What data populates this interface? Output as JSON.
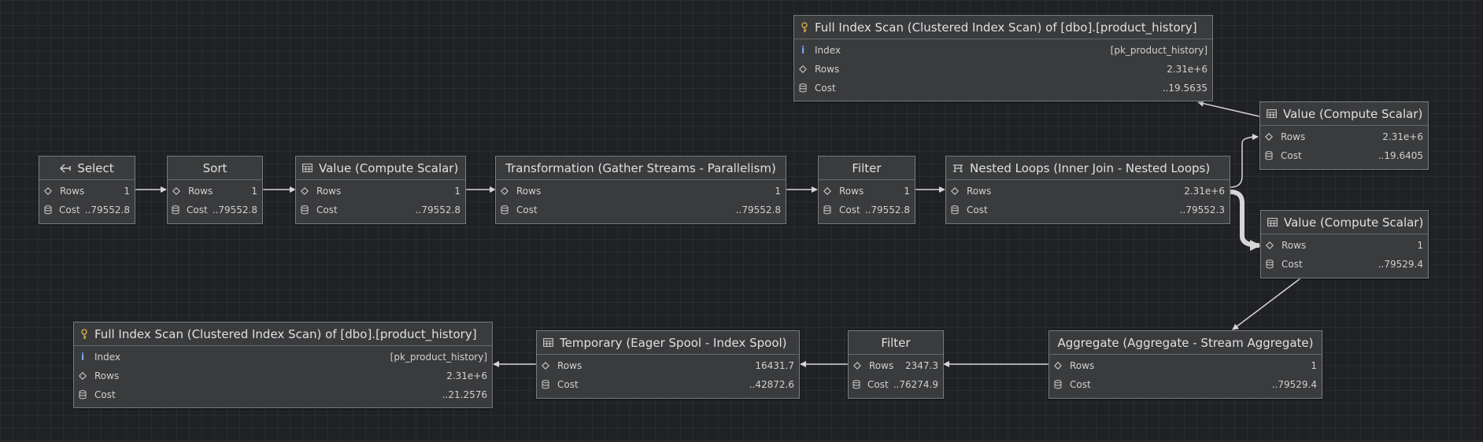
{
  "nodes": {
    "select": {
      "title": "Select",
      "icon": "select-arrow-icon",
      "rows_label": "Rows",
      "rows": "1",
      "cost_label": "Cost",
      "cost": "..79552.8"
    },
    "sort": {
      "title": "Sort",
      "rows_label": "Rows",
      "rows": "1",
      "cost_label": "Cost",
      "cost": "..79552.8"
    },
    "compute1": {
      "title": "Value (Compute Scalar)",
      "icon": "table-icon",
      "rows_label": "Rows",
      "rows": "1",
      "cost_label": "Cost",
      "cost": "..79552.8"
    },
    "gather": {
      "title": "Transformation (Gather Streams - Parallelism)",
      "rows_label": "Rows",
      "rows": "1",
      "cost_label": "Cost",
      "cost": "..79552.8"
    },
    "filter1": {
      "title": "Filter",
      "rows_label": "Rows",
      "rows": "1",
      "cost_label": "Cost",
      "cost": "..79552.8"
    },
    "nested": {
      "title": "Nested Loops (Inner Join - Nested Loops)",
      "icon": "join-icon",
      "rows_label": "Rows",
      "rows": "2.31e+6",
      "cost_label": "Cost",
      "cost": "..79552.3"
    },
    "scan_top": {
      "title": "Full Index Scan (Clustered Index Scan) of [dbo].[product_history]",
      "icon": "key-icon",
      "index_label": "Index",
      "index": "[pk_product_history]",
      "rows_label": "Rows",
      "rows": "2.31e+6",
      "cost_label": "Cost",
      "cost": "..19.5635"
    },
    "compute_top": {
      "title": "Value (Compute Scalar)",
      "icon": "table-icon",
      "rows_label": "Rows",
      "rows": "2.31e+6",
      "cost_label": "Cost",
      "cost": "..19.6405"
    },
    "compute_mid": {
      "title": "Value (Compute Scalar)",
      "icon": "table-icon",
      "rows_label": "Rows",
      "rows": "1",
      "cost_label": "Cost",
      "cost": "..79529.4"
    },
    "aggregate": {
      "title": "Aggregate (Aggregate - Stream Aggregate)",
      "rows_label": "Rows",
      "rows": "1",
      "cost_label": "Cost",
      "cost": "..79529.4"
    },
    "filter2": {
      "title": "Filter",
      "rows_label": "Rows",
      "rows": "2347.3",
      "cost_label": "Cost",
      "cost": "..76274.9"
    },
    "spool": {
      "title": "Temporary (Eager Spool - Index Spool)",
      "icon": "table-icon",
      "rows_label": "Rows",
      "rows": "16431.7",
      "cost_label": "Cost",
      "cost": "..42872.6"
    },
    "scan_bottom": {
      "title": "Full Index Scan (Clustered Index Scan) of [dbo].[product_history]",
      "icon": "key-icon",
      "index_label": "Index",
      "index": "[pk_product_history]",
      "rows_label": "Rows",
      "rows": "2.31e+6",
      "cost_label": "Cost",
      "cost": "..21.2576"
    }
  }
}
